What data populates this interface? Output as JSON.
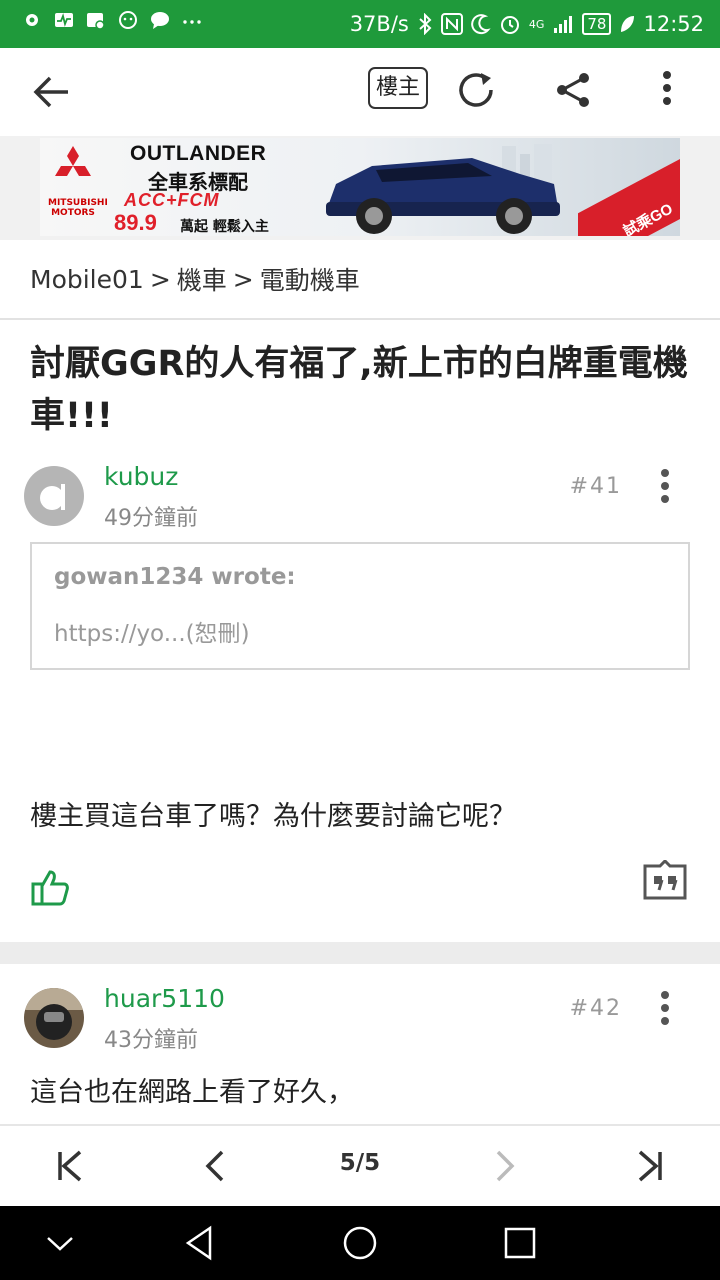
{
  "status_bar": {
    "net_speed": "37B/s",
    "network": "4G",
    "battery": "78",
    "time": "12:52"
  },
  "app_bar": {
    "op_label": "樓主"
  },
  "banner": {
    "brand": "MITSUBISHI MOTORS",
    "headline": "OUTLANDER",
    "sub": "全車系標配",
    "tag": "ACC+FCM",
    "price": "89.9",
    "price_sub": "萬起 輕鬆入主",
    "cta": "試乘GO"
  },
  "breadcrumb": {
    "items": [
      "Mobile01",
      "機車",
      "電動機車"
    ],
    "separator": ">"
  },
  "thread": {
    "title": "討厭GGR的人有福了,新上市的白牌重電機車!!!"
  },
  "posts": [
    {
      "author": "kubuz",
      "time": "49分鐘前",
      "floor": "#41",
      "quote": {
        "author": "gowan1234 wrote:",
        "text": "https://yo...(恕刪)"
      },
      "body": "樓主買這台車了嗎？為什麼要討論它呢？"
    },
    {
      "author": "huar5110",
      "time": "43分鐘前",
      "floor": "#42",
      "body": "這台也在網路上看了好久，"
    }
  ],
  "pager": {
    "label": "5/5"
  },
  "colors": {
    "status_bar": "#1f9a3b",
    "author": "#1e9a4a",
    "like": "#1e9a4a"
  }
}
